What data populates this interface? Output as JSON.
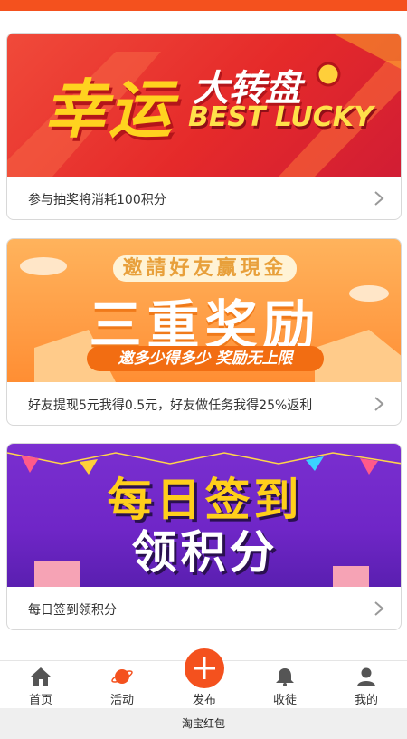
{
  "colors": {
    "accent": "#f4511e"
  },
  "cards": [
    {
      "banner_lines": [
        "幸运",
        "大转盘",
        "BEST LUCKY"
      ],
      "text": "参与抽奖将消耗100积分"
    },
    {
      "banner_lines": [
        "邀請好友赢現金",
        "三重奖励",
        "邀多少得多少 奖励无上限"
      ],
      "text": "好友提现5元我得0.5元，好友做任务我得25%返利"
    },
    {
      "banner_lines": [
        "每日签到",
        "领积分"
      ],
      "text": "每日签到领积分"
    }
  ],
  "nav": {
    "home": "首页",
    "activity": "活动",
    "publish": "发布",
    "apprentice": "收徒",
    "mine": "我的"
  },
  "footer_title": "淘宝红包"
}
